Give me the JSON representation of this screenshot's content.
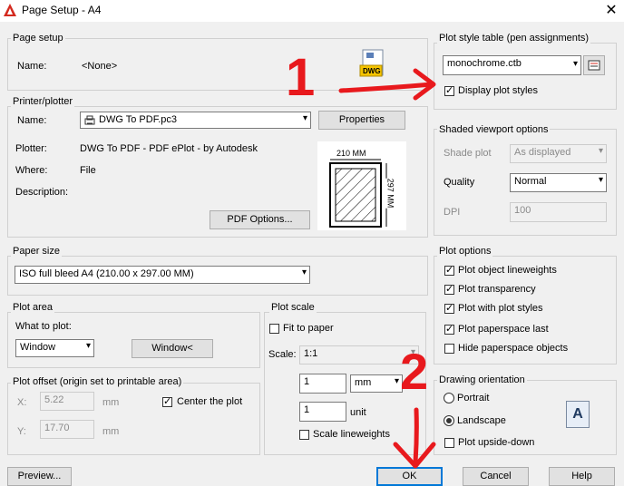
{
  "window": {
    "title": "Page Setup - A4",
    "close_glyph": "✕"
  },
  "page_setup": {
    "group": "Page setup",
    "name_label": "Name:",
    "name_value": "<None>",
    "dwg_icon_text": "DWG"
  },
  "printer": {
    "group": "Printer/plotter",
    "name_label": "Name:",
    "name_value": "DWG To PDF.pc3",
    "properties_button": "Properties",
    "plotter_label": "Plotter:",
    "plotter_value": "DWG To PDF - PDF ePlot - by Autodesk",
    "where_label": "Where:",
    "where_value": "File",
    "description_label": "Description:",
    "pdf_options_button": "PDF Options...",
    "preview_width": "210 MM",
    "preview_height": "297 MM"
  },
  "paper_size": {
    "group": "Paper size",
    "value": "ISO full bleed A4 (210.00 x 297.00 MM)"
  },
  "plot_area": {
    "group": "Plot area",
    "what_label": "What to plot:",
    "what_value": "Window",
    "window_button": "Window<"
  },
  "plot_offset": {
    "group": "Plot offset (origin set to printable area)",
    "x_label": "X:",
    "x_value": "5.22",
    "x_unit": "mm",
    "y_label": "Y:",
    "y_value": "17.70",
    "y_unit": "mm",
    "center_label": "Center the plot",
    "center_checked": true
  },
  "plot_scale": {
    "group": "Plot scale",
    "fit_label": "Fit to paper",
    "fit_checked": false,
    "scale_label": "Scale:",
    "scale_value": "1:1",
    "value1": "1",
    "unit1": "mm",
    "value2": "1",
    "unit2": "unit",
    "lineweights_label": "Scale lineweights",
    "lineweights_checked": false
  },
  "plot_style": {
    "group": "Plot style table (pen assignments)",
    "value": "monochrome.ctb",
    "display_label": "Display plot styles",
    "display_checked": true
  },
  "shaded": {
    "group": "Shaded viewport options",
    "shade_label": "Shade plot",
    "shade_value": "As displayed",
    "quality_label": "Quality",
    "quality_value": "Normal",
    "dpi_label": "DPI",
    "dpi_value": "100"
  },
  "plot_options": {
    "group": "Plot options",
    "items": [
      {
        "label": "Plot object lineweights",
        "checked": true
      },
      {
        "label": "Plot transparency",
        "checked": true
      },
      {
        "label": "Plot with plot styles",
        "checked": true
      },
      {
        "label": "Plot paperspace last",
        "checked": true
      },
      {
        "label": "Hide paperspace objects",
        "checked": false
      }
    ]
  },
  "orientation": {
    "group": "Drawing orientation",
    "portrait_label": "Portrait",
    "landscape_label": "Landscape",
    "selected": "Landscape",
    "upside_down_label": "Plot upside-down",
    "upside_down_checked": false,
    "icon_letter": "A"
  },
  "buttons": {
    "preview": "Preview...",
    "ok": "OK",
    "cancel": "Cancel",
    "help": "Help"
  },
  "annotations": {
    "number_1": "1",
    "number_2": "2",
    "ink_color": "#e8191d"
  },
  "colors": {
    "accent": "#0078d7",
    "dwg_yellow": "#f5c400",
    "autocad_red": "#d42a1f"
  }
}
